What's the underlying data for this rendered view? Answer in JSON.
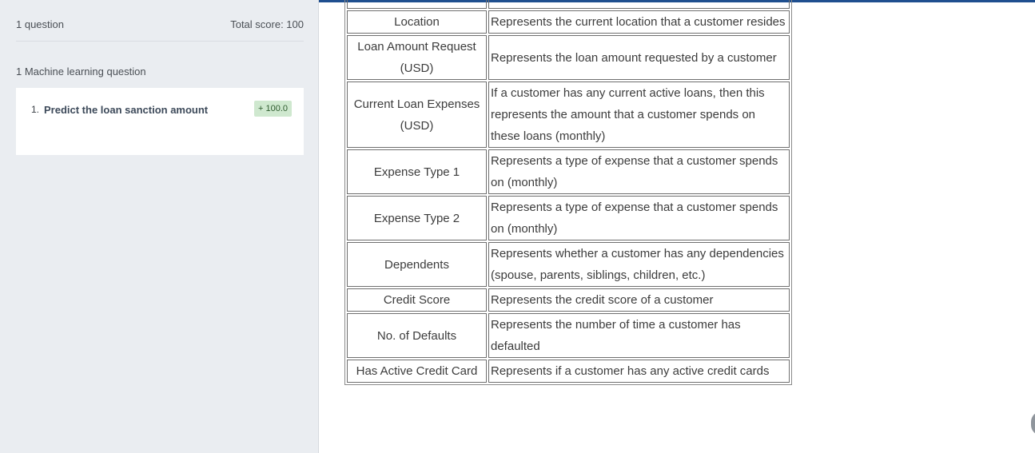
{
  "sidebar": {
    "question_count": "1 question",
    "total_score": "Total score: 100",
    "section_title": "1 Machine learning question",
    "questions": [
      {
        "number": "1.",
        "title": "Predict the loan sanction amount",
        "score": "+ 100.0"
      }
    ]
  },
  "table": {
    "rows": [
      {
        "name": "",
        "description": ""
      },
      {
        "name": "Location",
        "description": "Represents the current location that a customer resides"
      },
      {
        "name": "Loan Amount Request (USD)",
        "description": "Represents the loan amount requested by a customer"
      },
      {
        "name": "Current Loan Expenses (USD)",
        "description": "If a customer has any current active loans, then this represents the amount that a customer spends on these loans (monthly)"
      },
      {
        "name": "Expense Type 1",
        "description": "Represents a type of expense that a customer spends on (monthly)"
      },
      {
        "name": "Expense Type 2",
        "description": "Represents a type of expense that a customer spends on (monthly)"
      },
      {
        "name": "Dependents",
        "description": "Represents whether a customer has any dependencies (spouse, parents, siblings, children, etc.)"
      },
      {
        "name": "Credit Score",
        "description": "Represents the credit score of a customer"
      },
      {
        "name": "No. of Defaults",
        "description": "Represents the number of time a customer has defaulted"
      },
      {
        "name": "Has Active Credit Card",
        "description": "Represents if a customer has any active credit cards"
      }
    ]
  },
  "colors": {
    "accent": "#1f4f8f",
    "score_badge_bg": "#cfe8cf",
    "sidebar_bg": "#eaedf1"
  }
}
